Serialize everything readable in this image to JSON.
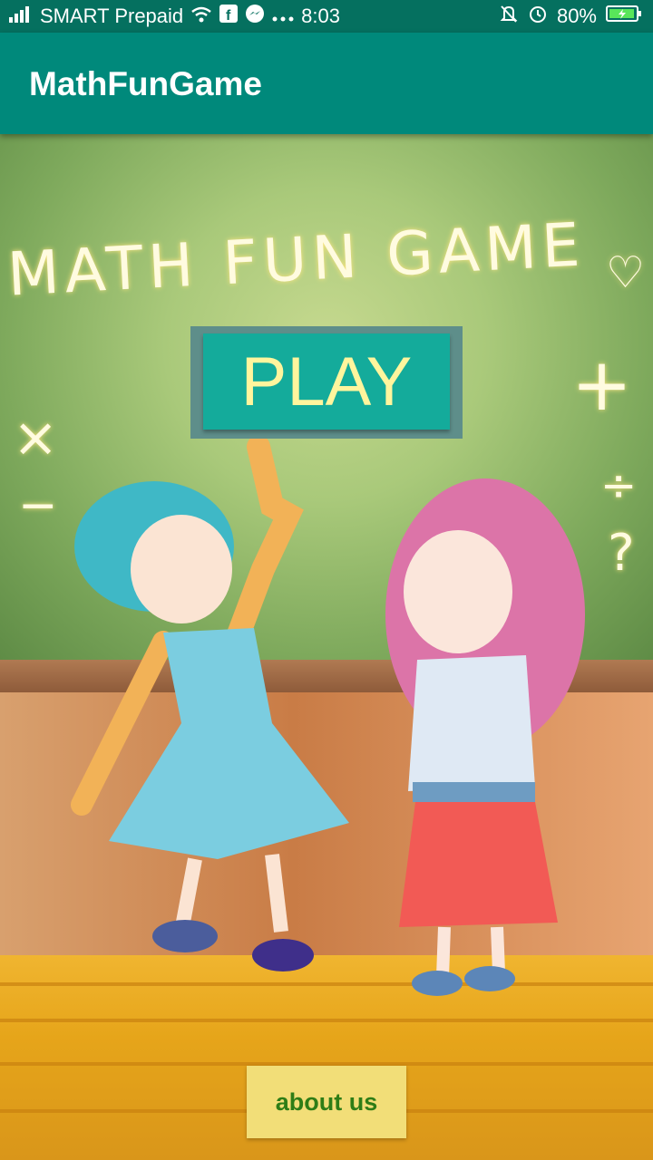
{
  "status_bar": {
    "carrier": "SMART Prepaid",
    "time": "8:03",
    "battery": "80%",
    "icons": [
      "signal-icon",
      "wifi-icon",
      "facebook-icon",
      "messenger-icon",
      "more-icon",
      "mute-icon",
      "alarm-icon",
      "battery-icon"
    ]
  },
  "app_bar": {
    "title": "MathFunGame"
  },
  "illustration": {
    "chalk_title": "MATH FUN GAME",
    "symbols": [
      "×",
      "−",
      "+",
      "÷",
      "?",
      "♡"
    ]
  },
  "buttons": {
    "play": "PLAY",
    "about": "about us"
  },
  "colors": {
    "primary": "#00897b",
    "status_bar": "#05705f",
    "play_button": "#14ab9b",
    "play_text": "#fff59d",
    "about_button": "#f2de78",
    "about_text": "#2e7d16"
  }
}
